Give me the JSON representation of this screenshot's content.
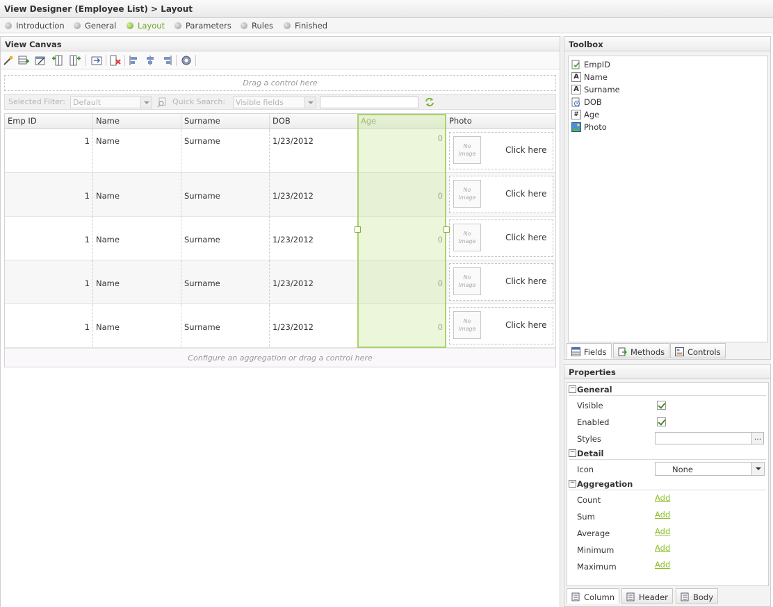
{
  "window": {
    "title": "View Designer (Employee List) > Layout"
  },
  "steps": [
    {
      "label": "Introduction",
      "active": false
    },
    {
      "label": "General",
      "active": false
    },
    {
      "label": "Layout",
      "active": true
    },
    {
      "label": "Parameters",
      "active": false
    },
    {
      "label": "Rules",
      "active": false
    },
    {
      "label": "Finished",
      "active": false
    }
  ],
  "canvas": {
    "title": "View Canvas",
    "drop_hint": "Drag a control here",
    "filter": {
      "selected_filter_label": "Selected Filter:",
      "selected_filter_value": "Default",
      "quick_search_label": "Quick Search:",
      "quick_search_value": "Visible fields",
      "search_value": ""
    },
    "columns": [
      "Emp ID",
      "Name",
      "Surname",
      "DOB",
      "Age",
      "Photo"
    ],
    "rows": [
      {
        "emp_id": "1",
        "name": "Name",
        "surname": "Surname",
        "dob": "1/23/2012",
        "age": "0",
        "no_image": "No Image",
        "click": "Click here"
      },
      {
        "emp_id": "1",
        "name": "Name",
        "surname": "Surname",
        "dob": "1/23/2012",
        "age": "0",
        "no_image": "No Image",
        "click": "Click here"
      },
      {
        "emp_id": "1",
        "name": "Name",
        "surname": "Surname",
        "dob": "1/23/2012",
        "age": "0",
        "no_image": "No Image",
        "click": "Click here"
      },
      {
        "emp_id": "1",
        "name": "Name",
        "surname": "Surname",
        "dob": "1/23/2012",
        "age": "0",
        "no_image": "No Image",
        "click": "Click here"
      },
      {
        "emp_id": "1",
        "name": "Name",
        "surname": "Surname",
        "dob": "1/23/2012",
        "age": "0",
        "no_image": "No Image",
        "click": "Click here"
      }
    ],
    "footer_hint": "Configure an aggregation or drag a control here"
  },
  "toolbox": {
    "title": "Toolbox",
    "items": [
      {
        "label": "EmpID",
        "icon": "id-field-icon"
      },
      {
        "label": "Name",
        "icon": "text-field-icon"
      },
      {
        "label": "Surname",
        "icon": "text-field-icon"
      },
      {
        "label": "DOB",
        "icon": "date-field-icon"
      },
      {
        "label": "Age",
        "icon": "number-field-icon"
      },
      {
        "label": "Photo",
        "icon": "image-field-icon"
      }
    ],
    "tabs": [
      "Fields",
      "Methods",
      "Controls"
    ]
  },
  "properties": {
    "title": "Properties",
    "sections": {
      "general": "General",
      "detail": "Detail",
      "aggregation": "Aggregation"
    },
    "visible_label": "Visible",
    "enabled_label": "Enabled",
    "styles_label": "Styles",
    "styles_button": "...",
    "icon_label": "Icon",
    "icon_value": "None",
    "count_label": "Count",
    "sum_label": "Sum",
    "average_label": "Average",
    "minimum_label": "Minimum",
    "maximum_label": "Maximum",
    "add_link": "Add",
    "tabs": [
      "Column",
      "Header",
      "Body"
    ]
  },
  "colors": {
    "accent": "#6aa826",
    "link": "#8cbf26",
    "selection": "#a9d26a"
  }
}
